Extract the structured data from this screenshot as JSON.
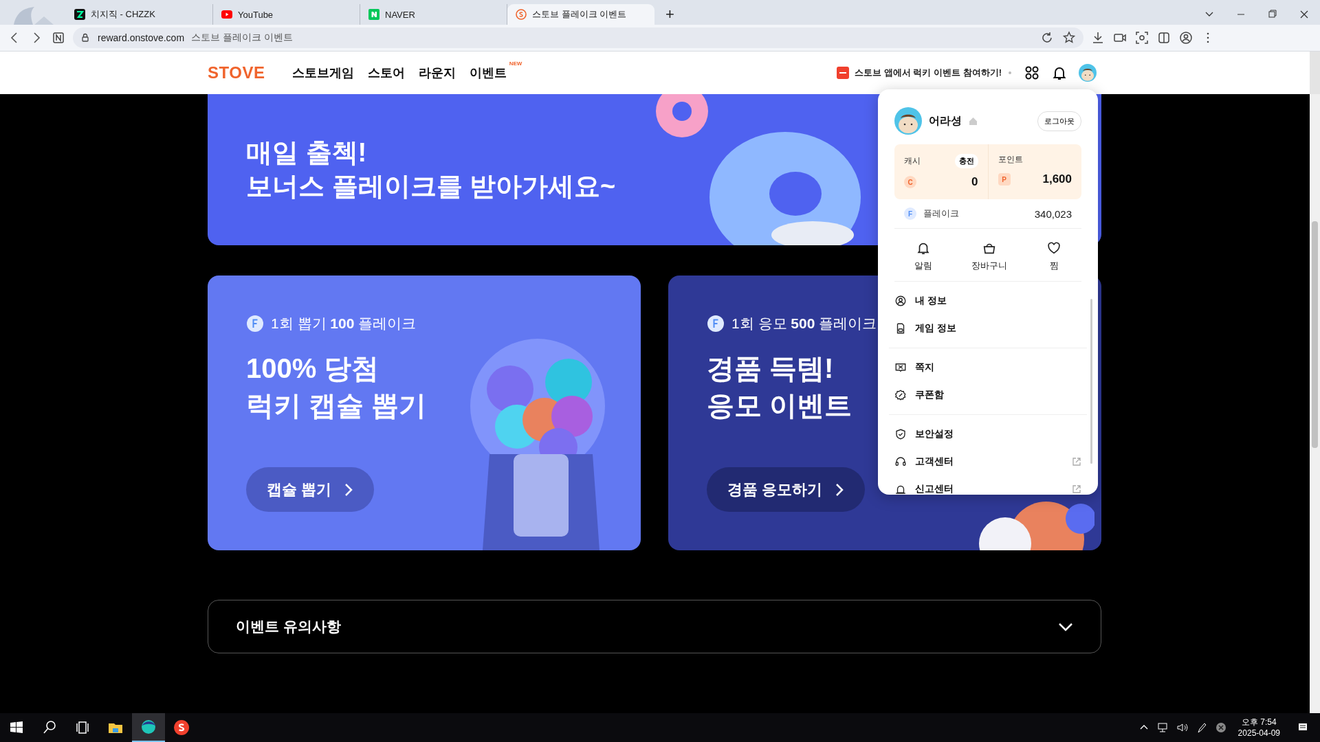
{
  "browser": {
    "tabs": [
      {
        "kind": "chzzk",
        "title": "치지직 - CHZZK",
        "selected": false
      },
      {
        "kind": "youtube",
        "title": "YouTube",
        "selected": false
      },
      {
        "kind": "naver",
        "title": "NAVER",
        "selected": false
      },
      {
        "kind": "stove",
        "title": "스토브 플레이크 이벤트",
        "selected": true
      }
    ],
    "new_tab": "+",
    "url": "reward.onstove.com",
    "page_title": "스토브 플레이크 이벤트"
  },
  "site_header": {
    "logo": "STOVE",
    "nav": [
      {
        "label": "스토브게임"
      },
      {
        "label": "스토어"
      },
      {
        "label": "라운지"
      },
      {
        "label": "이벤트",
        "badge": "NEW"
      }
    ],
    "promo": "스토브 앱에서 럭키 이벤트 참여하기!"
  },
  "banner": {
    "lines": [
      "매일 출첵!",
      "보너스 플레이크를 받아가세요~"
    ]
  },
  "cards": [
    {
      "kind": "capsule",
      "subtitle": "1회 뽑기 **100** 플레이크",
      "title_lines": [
        "100% 당첨",
        "럭키 캡슐 뽑기"
      ],
      "button": "캡슐 뽑기"
    },
    {
      "kind": "raffle",
      "subtitle": "1회 응모 **500** 플레이크",
      "title_lines": [
        "경품 득템!",
        "응모 이벤트"
      ],
      "button": "경품 응모하기"
    }
  ],
  "notice": {
    "title": "이벤트 유의사항",
    "expanded": false
  },
  "profile_menu": {
    "username": "어라셩",
    "logout": "로그아웃",
    "cash": {
      "label": "캐시",
      "charge": "충전",
      "symbol": "C",
      "value": "0"
    },
    "point": {
      "label": "포인트",
      "symbol": "P",
      "value": "1,600"
    },
    "flake": {
      "symbol": "F",
      "label": "플레이크",
      "value": "340,023"
    },
    "shortcuts": [
      {
        "kind": "bell",
        "label": "알림"
      },
      {
        "kind": "basket",
        "label": "장바구니"
      },
      {
        "kind": "heart",
        "label": "찜"
      }
    ],
    "groups": [
      [
        {
          "kind": "profile",
          "label": "내 정보",
          "external": false
        },
        {
          "kind": "game",
          "label": "게임 정보",
          "external": false
        }
      ],
      [
        {
          "kind": "message",
          "label": "쪽지",
          "external": false
        },
        {
          "kind": "coupon",
          "label": "쿠폰함",
          "external": false
        }
      ],
      [
        {
          "kind": "security",
          "label": "보안설정",
          "external": false
        },
        {
          "kind": "support",
          "label": "고객센터",
          "external": true
        },
        {
          "kind": "report",
          "label": "신고센터",
          "external": true
        }
      ]
    ]
  },
  "taskbar": {
    "time": "오후 7:54",
    "date": "2025-04-09"
  }
}
